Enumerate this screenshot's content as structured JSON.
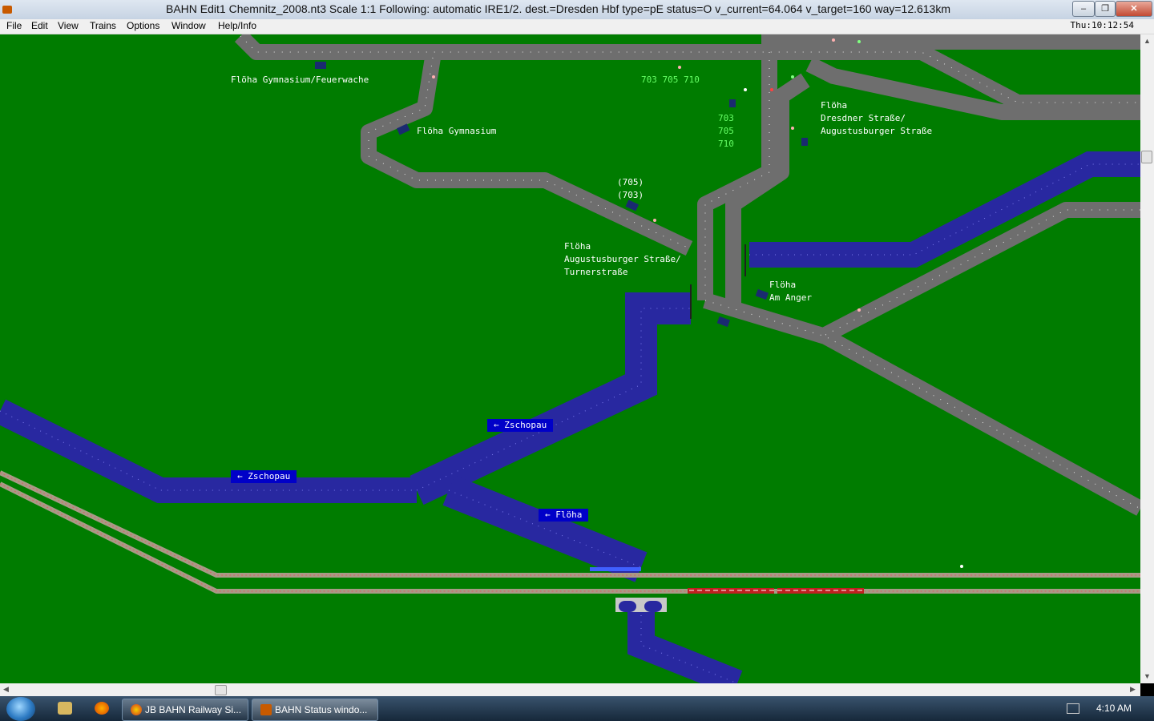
{
  "window": {
    "title": "BAHN Edit1 Chemnitz_2008.nt3 Scale 1:1 Following: automatic IRE1/2.  dest.=Dresden Hbf type=pE status=O  v_current=64.064 v_target=160 way=12.613km",
    "minimize": "–",
    "maximize": "❐",
    "close": "✕"
  },
  "menu": {
    "items": [
      "File",
      "Edit",
      "View",
      "Trains",
      "Options",
      "Window",
      "Help/Info"
    ],
    "clock": "Thu:10:12:54"
  },
  "map": {
    "stops": {
      "gymnasium_feuerwache": "Flöha Gymnasium/Feuerwache",
      "gymnasium": "Flöha Gymnasium",
      "dresdner": "Flöha\nDresdner Straße/\nAugustusburger Straße",
      "augustusburger": "Flöha\nAugustusburger Straße/\nTurnerstraße",
      "am_anger": "Flöha\nAm Anger"
    },
    "lines": {
      "top": "703 705 710",
      "vertical": "703\n705\n710",
      "bracket": "(705)\n(703)"
    },
    "rivers": {
      "zschopau_1": "← Zschopau",
      "zschopau_2": "← Zschopau",
      "floeha": "← Flöha"
    }
  },
  "taskbar": {
    "tasks": [
      "JB BAHN Railway Si...",
      "BAHN Status windo..."
    ],
    "time": "4:10 AM"
  },
  "colors": {
    "grass": "#007c00",
    "road": "#6e6e6e",
    "river": "#2828a0",
    "rail": "#a89a86"
  }
}
